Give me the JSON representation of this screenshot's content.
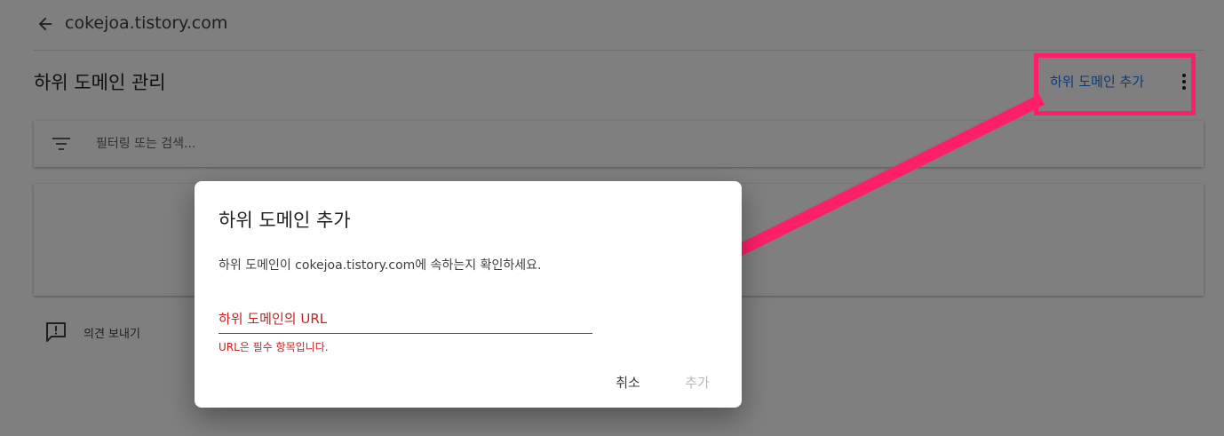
{
  "topbar": {
    "site_name": "cokejoa.tistory.com",
    "back_icon": "arrow-left-icon"
  },
  "section": {
    "title": "하위 도메인 관리",
    "add_label": "하위 도메인 추가",
    "more_icon": "more-vert-icon"
  },
  "filter": {
    "placeholder": "필터링 또는 검색...",
    "icon": "filter-icon"
  },
  "feedback": {
    "label": "의견 보내기",
    "icon": "feedback-icon"
  },
  "dialog": {
    "title": "하위 도메인 추가",
    "description": "하위 도메인이 cokejoa.tistory.com에 속하는지 확인하세요.",
    "url_placeholder": "하위 도메인의 URL",
    "url_error": "URL은 필수 항목입니다.",
    "cancel_label": "취소",
    "add_label": "추가"
  },
  "colors": {
    "accent": "#1a73e8",
    "error": "#c5221f",
    "annotation": "#ff1f68"
  }
}
